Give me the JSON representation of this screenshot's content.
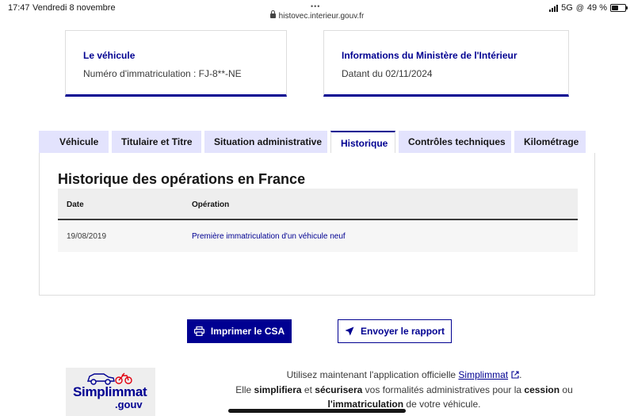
{
  "statusbar": {
    "time": "17:47",
    "date": "Vendredi 8 novembre",
    "url": "histovec.interieur.gouv.fr",
    "network": "5G",
    "battery": "49 %",
    "battery_level": 0.49
  },
  "cards": {
    "vehicle": {
      "title": "Le véhicule",
      "value": "Numéro d'immatriculation : FJ-8**-NE"
    },
    "ministry": {
      "title": "Informations du Ministère de l'Intérieur",
      "value": "Datant du 02/11/2024"
    }
  },
  "tabs": [
    {
      "label": "Véhicule"
    },
    {
      "label": "Titulaire et Titre"
    },
    {
      "label": "Situation administrative"
    },
    {
      "label": "Historique"
    },
    {
      "label": "Contrôles techniques"
    },
    {
      "label": "Kilométrage"
    }
  ],
  "active_tab": "Historique",
  "history": {
    "heading": "Historique des opérations en France",
    "columns": [
      "Date",
      "Opération"
    ],
    "rows": [
      {
        "date": "19/08/2019",
        "operation": "Première immatriculation d'un véhicule neuf"
      }
    ]
  },
  "actions": {
    "print_label": "Imprimer le CSA",
    "send_label": "Envoyer le rapport"
  },
  "promo": {
    "logo_main": "Simplimmat",
    "logo_sub": ".gouv",
    "line1_prefix": "Utilisez maintenant l'application officielle ",
    "line1_link": "Simplimmat",
    "line1_suffix": ".",
    "line2_a": "Elle ",
    "line2_b": "simplifiera",
    "line2_c": " et ",
    "line2_d": "sécurisera",
    "line2_e": " vos formalités administratives pour la ",
    "line2_f": "cession",
    "line2_g": " ou",
    "line3_a": "l'immatriculation",
    "line3_b": " de votre véhicule."
  },
  "colors": {
    "brand_blue": "#000091",
    "tab_inactive": "#e3e3fd",
    "table_header": "#eeeeee"
  },
  "icons": [
    "lock-icon",
    "signal-icon",
    "battery-icon",
    "printer-icon",
    "send-icon",
    "external-link-icon",
    "car-icon",
    "motorcycle-icon"
  ]
}
